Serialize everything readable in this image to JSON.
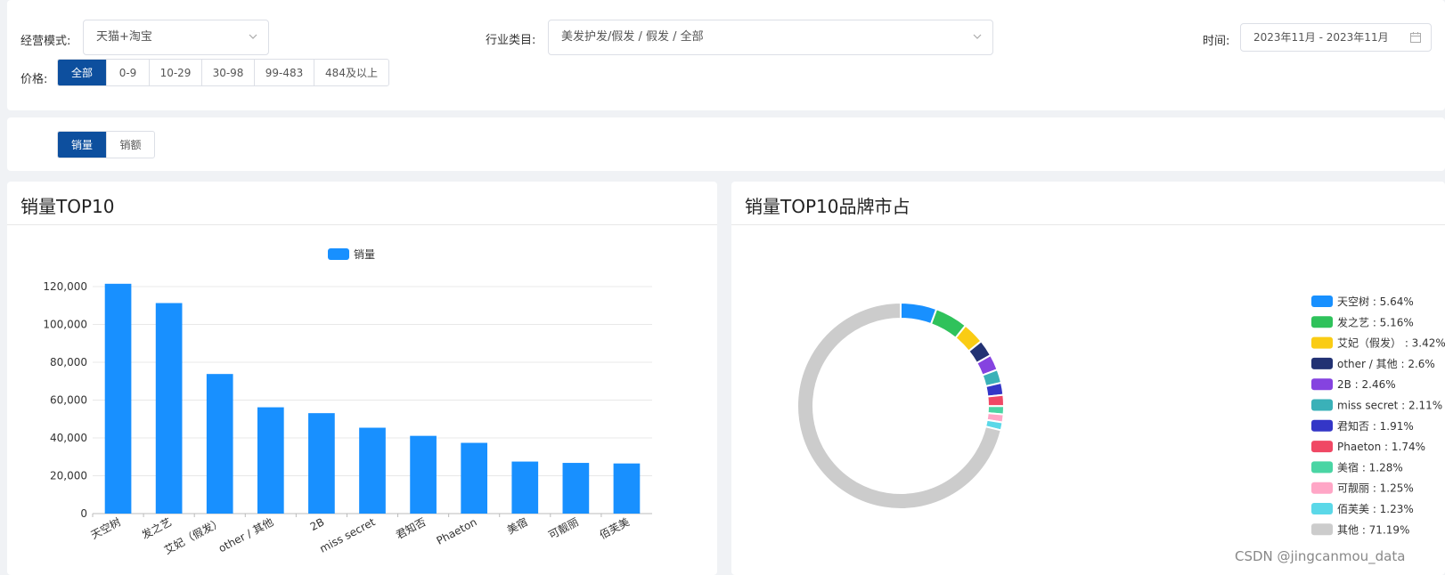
{
  "filters": {
    "business_mode": {
      "label": "经营模式:",
      "value": "天猫+淘宝"
    },
    "industry": {
      "label": "行业类目:",
      "value": "美发护发/假发 / 假发 / 全部"
    },
    "time": {
      "label": "时间:",
      "value": "2023年11月 - 2023年11月"
    },
    "price": {
      "label": "价格:",
      "options": [
        "全部",
        "0-9",
        "10-29",
        "30-98",
        "99-483",
        "484及以上"
      ],
      "selected": "全部"
    }
  },
  "metric_toggle": {
    "options": [
      "销量",
      "销额"
    ],
    "selected": "销量"
  },
  "left_card": {
    "title": "销量TOP10"
  },
  "right_card": {
    "title": "销量TOP10品牌市占"
  },
  "chart_data": [
    {
      "type": "bar",
      "title": "销量TOP10",
      "legend": [
        "销量"
      ],
      "legend_position": "top-center",
      "categories": [
        "天空树",
        "发之艺",
        "艾妃（假发）",
        "other / 其他",
        "2B",
        "miss secret",
        "君知否",
        "Phaeton",
        "美宿",
        "可靓丽",
        "佰芙美"
      ],
      "series": [
        {
          "name": "销量",
          "values": [
            121500,
            111300,
            73800,
            56200,
            53100,
            45400,
            41100,
            37400,
            27500,
            26800,
            26500
          ]
        }
      ],
      "ylim": [
        0,
        120000
      ],
      "yticks": [
        "0",
        "20,000",
        "40,000",
        "60,000",
        "80,000",
        "100,000",
        "120,000"
      ],
      "grid": true,
      "color": "#1890ff"
    },
    {
      "type": "pie",
      "subtype": "donut",
      "title": "销量TOP10品牌市占",
      "legend_position": "right",
      "slices": [
        {
          "label": "天空树",
          "value": 5.64,
          "text": "天空树 : 5.64%",
          "color": "#1890ff"
        },
        {
          "label": "发之艺",
          "value": 5.16,
          "text": "发之艺 : 5.16%",
          "color": "#2fc25b"
        },
        {
          "label": "艾妃（假发）",
          "value": 3.42,
          "text": "艾妃（假发） : 3.42%",
          "color": "#facc14"
        },
        {
          "label": "other / 其他",
          "value": 2.6,
          "text": "other / 其他 : 2.6%",
          "color": "#223273"
        },
        {
          "label": "2B",
          "value": 2.46,
          "text": "2B : 2.46%",
          "color": "#8543e0"
        },
        {
          "label": "miss secret",
          "value": 2.11,
          "text": "miss secret : 2.11%",
          "color": "#3ab1b8"
        },
        {
          "label": "君知否",
          "value": 1.91,
          "text": "君知否 : 1.91%",
          "color": "#3436c7"
        },
        {
          "label": "Phaeton",
          "value": 1.74,
          "text": "Phaeton : 1.74%",
          "color": "#f04864"
        },
        {
          "label": "美宿",
          "value": 1.28,
          "text": "美宿 : 1.28%",
          "color": "#4ad5a4"
        },
        {
          "label": "可靓丽",
          "value": 1.25,
          "text": "可靓丽 : 1.25%",
          "color": "#ffa6c6"
        },
        {
          "label": "佰芙美",
          "value": 1.23,
          "text": "佰芙美 : 1.23%",
          "color": "#5bd8e8"
        },
        {
          "label": "其他",
          "value": 71.19,
          "text": "其他 : 71.19%",
          "color": "#cccccc"
        }
      ]
    }
  ],
  "watermark": "CSDN @jingcanmou_data"
}
